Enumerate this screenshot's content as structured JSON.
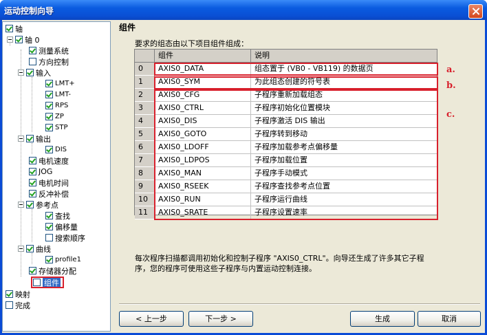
{
  "window": {
    "title": "运动控制向导"
  },
  "tree": {
    "items": [
      {
        "label": "轴",
        "checked": true,
        "expander": false
      },
      {
        "label": "轴 0",
        "checked": true,
        "expander": true
      },
      {
        "label": "测量系统",
        "checked": true
      },
      {
        "label": "方向控制",
        "checked": false
      },
      {
        "label": "输入",
        "checked": true,
        "expander": true
      },
      {
        "label": "LMT+",
        "checked": true
      },
      {
        "label": "LMT-",
        "checked": true
      },
      {
        "label": "RPS",
        "checked": true
      },
      {
        "label": "ZP",
        "checked": true
      },
      {
        "label": "STP",
        "checked": true
      },
      {
        "label": "输出",
        "checked": true,
        "expander": true
      },
      {
        "label": "DIS",
        "checked": true
      },
      {
        "label": "电机速度",
        "checked": true
      },
      {
        "label": "JOG",
        "checked": true
      },
      {
        "label": "电机时间",
        "checked": true
      },
      {
        "label": "反冲补偿",
        "checked": true
      },
      {
        "label": "参考点",
        "checked": true,
        "expander": true
      },
      {
        "label": "查找",
        "checked": true
      },
      {
        "label": "偏移量",
        "checked": true
      },
      {
        "label": "搜索顺序",
        "checked": false
      },
      {
        "label": "曲线",
        "checked": true,
        "expander": true
      },
      {
        "label": "profile1",
        "checked": true
      },
      {
        "label": "存储器分配",
        "checked": true
      },
      {
        "label": "组件",
        "checked": false,
        "selected": true
      },
      {
        "label": "映射",
        "checked": true
      },
      {
        "label": "完成",
        "checked": false
      }
    ]
  },
  "panel": {
    "title": "组件",
    "intro": "要求的组态由以下项目组件组成：",
    "columns": [
      "",
      "组件",
      "说明"
    ],
    "rows": [
      [
        "0",
        "AXIS0_DATA",
        "组态置于 (VB0 - VB119) 的数据页"
      ],
      [
        "1",
        "AXIS0_SYM",
        "为此组态创建的符号表"
      ],
      [
        "2",
        "AXIS0_CFG",
        "子程序重新加载组态"
      ],
      [
        "3",
        "AXIS0_CTRL",
        "子程序初始化位置模块"
      ],
      [
        "4",
        "AXIS0_DIS",
        "子程序激活 DIS 输出"
      ],
      [
        "5",
        "AXIS0_GOTO",
        "子程序转到移动"
      ],
      [
        "6",
        "AXIS0_LDOFF",
        "子程序加载参考点偏移量"
      ],
      [
        "7",
        "AXIS0_LDPOS",
        "子程序加载位置"
      ],
      [
        "8",
        "AXIS0_MAN",
        "子程序手动模式"
      ],
      [
        "9",
        "AXIS0_RSEEK",
        "子程序查找参考点位置"
      ],
      [
        "10",
        "AXIS0_RUN",
        "子程序运行曲线"
      ],
      [
        "11",
        "AXIS0_SRATE",
        "子程序设置速率"
      ]
    ],
    "annotations": [
      "a.",
      "b.",
      "c."
    ],
    "footer_line1": "每次程序扫描都调用初始化和控制子程序 \"AXIS0_CTRL\"。向导还生成了许多其它子程",
    "footer_line2": "序，您的程序可使用这些子程序与内置运动控制连接。"
  },
  "buttons": {
    "back": "< 上一步",
    "next": "下一步 >",
    "generate": "生成",
    "cancel": "取消"
  },
  "colors": {
    "title_bar": "#0a4fd4",
    "annotation": "#d8202c",
    "selection": "#316ac5"
  }
}
